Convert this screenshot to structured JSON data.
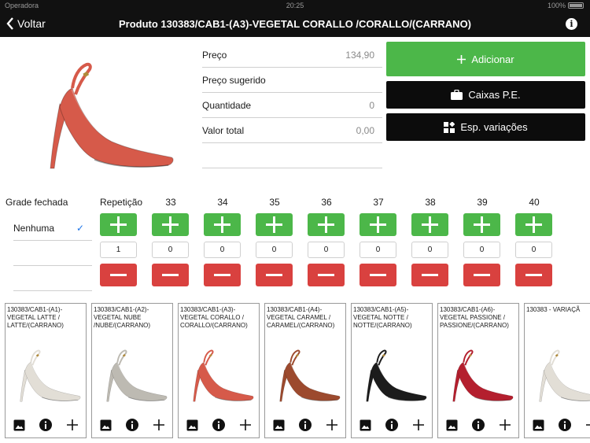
{
  "statusbar": {
    "carrier": "Operadora",
    "time": "20:25",
    "battery": "100%"
  },
  "navbar": {
    "back_label": "Voltar",
    "title": "Produto 130383/CAB1-(A3)-VEGETAL CORALLO /CORALLO/(CARRANO)"
  },
  "product": {
    "color": "#d65a4a"
  },
  "fields": [
    {
      "label": "Preço",
      "value": "134,90"
    },
    {
      "label": "Preço sugerido",
      "value": ""
    },
    {
      "label": "Quantidade",
      "value": "0"
    },
    {
      "label": "Valor total",
      "value": "0,00"
    }
  ],
  "actions": {
    "add_label": "Adicionar",
    "boxes_label": "Caixas P.E.",
    "variations_label": "Esp. variações"
  },
  "grade": {
    "label": "Grade fechada",
    "options": [
      "Nenhuma",
      "",
      ""
    ]
  },
  "grid": {
    "columns": [
      {
        "header": "Repetição",
        "value": "1"
      },
      {
        "header": "33",
        "value": "0"
      },
      {
        "header": "34",
        "value": "0"
      },
      {
        "header": "35",
        "value": "0"
      },
      {
        "header": "36",
        "value": "0"
      },
      {
        "header": "37",
        "value": "0"
      },
      {
        "header": "38",
        "value": "0"
      },
      {
        "header": "39",
        "value": "0"
      },
      {
        "header": "40",
        "value": "0"
      }
    ]
  },
  "cards": [
    {
      "title": "130383/CAB1-(A1)-VEGETAL LATTE / LATTE/(CARRANO)",
      "color": "#e2ded6"
    },
    {
      "title": "130383/CAB1-(A2)-VEGETAL NUBE /NUBE/(CARRANO)",
      "color": "#bdbab2"
    },
    {
      "title": "130383/CAB1-(A3)-VEGETAL CORALLO / CORALLO/(CARRANO)",
      "color": "#d65a4a"
    },
    {
      "title": "130383/CAB1-(A4)-VEGETAL CARAMEL / CARAMEL/(CARRANO)",
      "color": "#9c4a2e"
    },
    {
      "title": "130383/CAB1-(A5)-VEGETAL NOTTE / NOTTE/(CARRANO)",
      "color": "#1c1c1c"
    },
    {
      "title": "130383/CAB1-(A6)-VEGETAL PASSIONE / PASSIONE/(CARRANO)",
      "color": "#b41f2e"
    },
    {
      "title": "130383 - VARIAÇÃ",
      "color": "#e2ded6"
    }
  ],
  "icons": {
    "image": "image-icon",
    "info": "info-icon",
    "add": "plus-icon",
    "check": "checkmark-icon",
    "briefcase": "briefcase-icon",
    "grid": "variations-icon"
  }
}
